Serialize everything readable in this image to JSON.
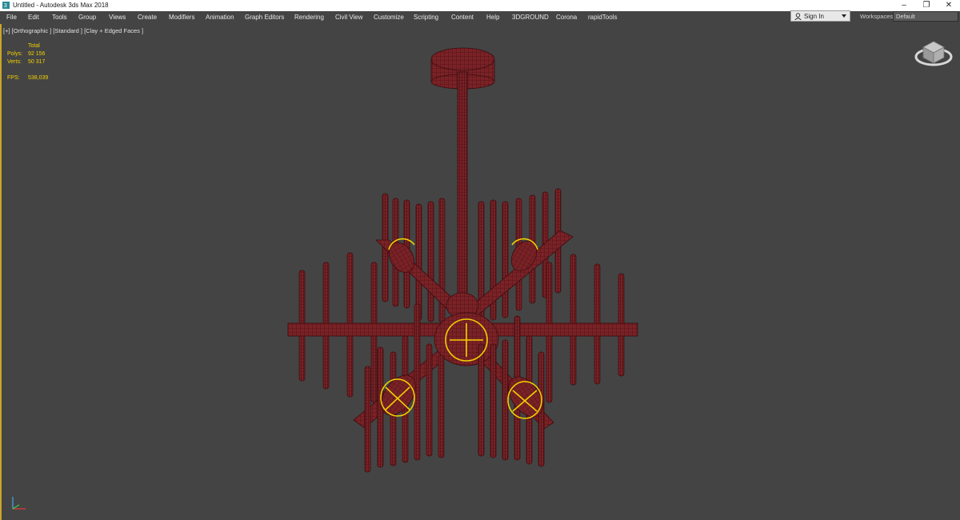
{
  "window": {
    "title": "Untitled - Autodesk 3ds Max 2018"
  },
  "menu": [
    "File",
    "Edit",
    "Tools",
    "Group",
    "Views",
    "Create",
    "Modifiers",
    "Animation",
    "Graph Editors",
    "Rendering",
    "Civil View",
    "Customize",
    "Scripting",
    "Content",
    "Help",
    "3DGROUND",
    "Corona",
    "rapidTools"
  ],
  "signin": {
    "label": "Sign In"
  },
  "workspaces": {
    "label": "Workspaces:",
    "value": "Default"
  },
  "viewport": {
    "label": "[+] [Orthographic ] [Standard ] [Clay + Edged Faces ]"
  },
  "stats": {
    "header": "Total",
    "polys_label": "Polys:",
    "polys": "92 156",
    "verts_label": "Verts:",
    "verts": "50 317",
    "fps_label": "FPS:",
    "fps": "538,039"
  },
  "colors": {
    "model": "#7a2226",
    "selection": "#f2d000",
    "viewport_bg": "#444444",
    "stats_text": "#f2d000"
  }
}
